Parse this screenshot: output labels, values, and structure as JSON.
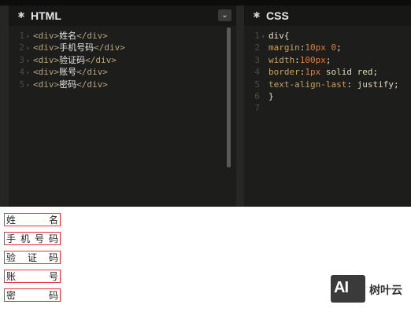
{
  "html_pane": {
    "title": "HTML",
    "collapse_icon": "chevron-down-icon",
    "lines": [
      {
        "num": "1",
        "open": "<div>",
        "text": "姓名",
        "close": "</div>"
      },
      {
        "num": "2",
        "open": "<div>",
        "text": "手机号码",
        "close": "</div>"
      },
      {
        "num": "3",
        "open": "<div>",
        "text": "验证码",
        "close": "</div>"
      },
      {
        "num": "4",
        "open": "<div>",
        "text": "账号",
        "close": "</div>"
      },
      {
        "num": "5",
        "open": "<div>",
        "text": "密码",
        "close": "</div>"
      }
    ]
  },
  "css_pane": {
    "title": "CSS",
    "lines": [
      {
        "num": "1",
        "code": "div{"
      },
      {
        "num": "2",
        "prop": "margin",
        "value": "10px 0"
      },
      {
        "num": "3",
        "prop": "width",
        "value": "100px"
      },
      {
        "num": "4",
        "prop": "border",
        "value": "1px solid red"
      },
      {
        "num": "5",
        "prop": "text-align-last",
        "value": " justify"
      },
      {
        "num": "6",
        "code": "}"
      },
      {
        "num": "7",
        "code": ""
      }
    ]
  },
  "output": {
    "items": [
      [
        "姓",
        "名"
      ],
      [
        "手",
        "机",
        "号",
        "码"
      ],
      [
        "验",
        "证",
        "码"
      ],
      [
        "账",
        "号"
      ],
      [
        "密",
        "码"
      ]
    ]
  },
  "watermark": {
    "logo": "AI",
    "text": "树叶云"
  },
  "colors": {
    "editor_bg": "#1e1f1d",
    "border_red": "#e8343c"
  }
}
